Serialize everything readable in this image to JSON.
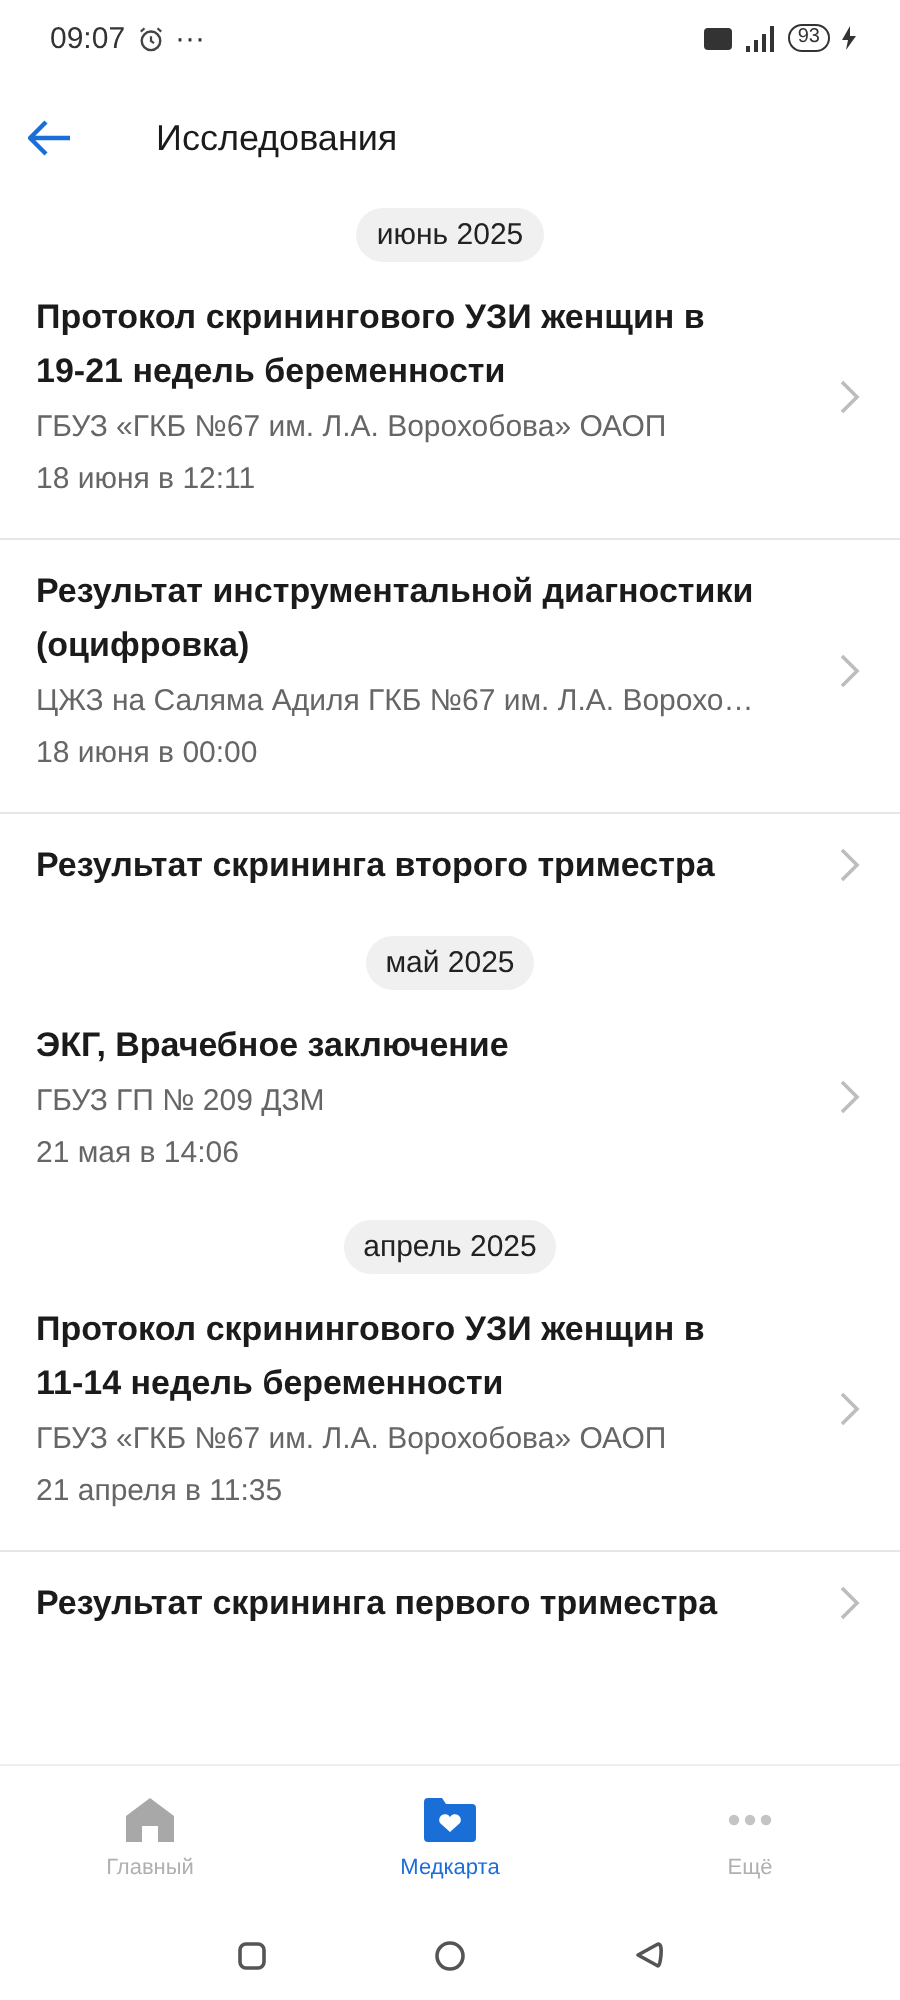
{
  "status_bar": {
    "time": "09:07",
    "dots": "···",
    "battery": "93"
  },
  "header": {
    "title": "Исследования"
  },
  "groups": [
    {
      "month": "июнь 2025",
      "items": [
        {
          "title": "Протокол скринингового УЗИ женщин в 19-21 недель беременности",
          "org": "ГБУЗ «ГКБ №67 им. Л.А. Ворохобова» ОАОП",
          "date": "18 июня в 12:11"
        },
        {
          "title": "Результат инструментальной диагностики (оцифровка)",
          "org": "ЦЖЗ на Саляма Адиля ГКБ №67 им. Л.А. Ворохо…",
          "date": "18 июня в 00:00"
        },
        {
          "title": "Результат скрининга второго триместра"
        }
      ]
    },
    {
      "month": "май 2025",
      "items": [
        {
          "title": "ЭКГ, Врачебное заключение",
          "org": "ГБУЗ ГП № 209 ДЗМ",
          "date": "21 мая в 14:06"
        }
      ]
    },
    {
      "month": "апрель 2025",
      "items": [
        {
          "title": "Протокол скринингового УЗИ женщин в 11-14 недель беременности",
          "org": "ГБУЗ «ГКБ №67 им. Л.А. Ворохобова» ОАОП",
          "date": "21 апреля в 11:35"
        },
        {
          "title": "Результат скрининга первого триместра"
        }
      ]
    }
  ],
  "bottom_nav": [
    {
      "kind": "home",
      "label": "Главный",
      "selected": false
    },
    {
      "kind": "medcard",
      "label": "Медкарта",
      "selected": true
    },
    {
      "kind": "more",
      "label": "Ещё",
      "selected": false
    }
  ]
}
